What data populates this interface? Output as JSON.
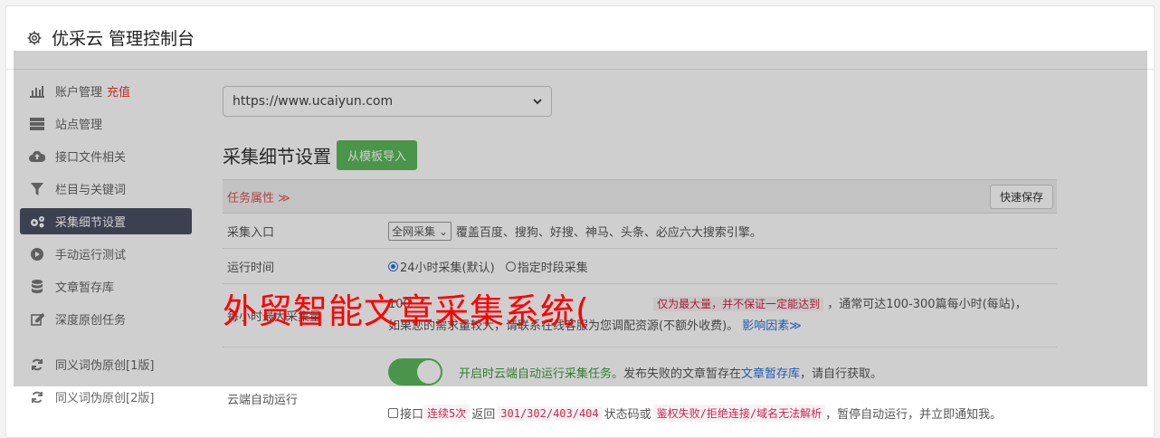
{
  "header": {
    "title": "优采云 管理控制台",
    "icon": "gear-icon"
  },
  "sidebar": {
    "items": [
      {
        "label": "账户管理",
        "extra": "充值",
        "icon": "bar-chart-icon"
      },
      {
        "label": "站点管理",
        "icon": "server-icon"
      },
      {
        "label": "接口文件相关",
        "icon": "cloud-upload-icon"
      },
      {
        "label": "栏目与关键词",
        "icon": "filter-icon"
      },
      {
        "label": "采集细节设置",
        "icon": "gears-icon",
        "active": true
      },
      {
        "label": "手动运行测试",
        "icon": "play-icon"
      },
      {
        "label": "文章暂存库",
        "icon": "database-icon"
      },
      {
        "label": "深度原创任务",
        "icon": "edit-icon"
      },
      {
        "label": "同义词伪原创[1版]",
        "icon": "refresh-icon"
      },
      {
        "label": "同义词伪原创[2版]",
        "icon": "refresh-icon"
      }
    ]
  },
  "main": {
    "site_select": "https://www.ucaiyun.com",
    "section_title": "采集细节设置",
    "import_button": "从模板导入",
    "task_label": "任务属性 ≫",
    "quick_save": "快速保存",
    "rows": {
      "entry": {
        "label": "采集入口",
        "select_value": "全网采集",
        "desc": "覆盖百度、搜狗、好搜、神马、头条、必应六大搜索引擎。"
      },
      "time": {
        "label": "运行时间",
        "option1": "24小时采集(默认)",
        "option2": "指定时段采集"
      },
      "hourly": {
        "label": "每小时最大采集量",
        "prefix": "100",
        "code": "仅为最大量，并不保证一定能达到",
        "suffix": "，通常可达100-300篇每小时(每站)，",
        "line2": "如果您的需求量较大，请联系在线客服为您调配资源(不额外收费)。",
        "link": "影响因素≫"
      },
      "cloud": {
        "label": "云端自动运行",
        "toggle_text": "开启时云端自动运行采集任务。",
        "toggle_desc": "发布失败的文章暂存在",
        "toggle_link": "文章暂存库",
        "toggle_end": "，请自行获取。",
        "cb_label": "接口",
        "code1": "连续5次",
        "mid1": "返回",
        "code2": "301/302/403/404",
        "mid2": "状态码或",
        "code3": "鉴权失败/拒绝连接/域名无法解析",
        "end": "，暂停自动运行，并立即通知我。"
      }
    }
  },
  "watermark": "外贸智能文章采集系统("
}
